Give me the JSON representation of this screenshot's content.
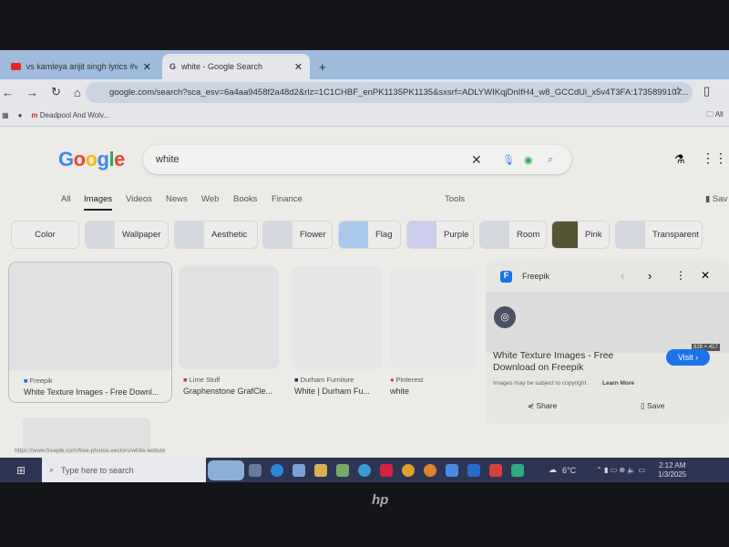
{
  "browser": {
    "tabs": [
      {
        "title": "vs kamleya arijit singh lyrics #v...",
        "icon": "youtube-icon",
        "active": false
      },
      {
        "title": "white - Google Search",
        "icon": "google-icon",
        "active": true
      }
    ],
    "new_tab": "+",
    "url": "google.com/search?sca_esv=6a4aa9458f2a48d2&rlz=1C1CHBF_enPK1135PK1135&sxsrf=ADLYWIKqjDnIfH4_w8_GCCdUi_x5v4T3FA:1735899107...",
    "bookmarks": [
      {
        "label": "Deadpool And Wolv...",
        "icon": "m-icon"
      }
    ],
    "all_bookmarks": "All"
  },
  "google": {
    "logo": "Google",
    "query": "white",
    "nav_tabs": [
      "All",
      "Images",
      "Videos",
      "News",
      "Web",
      "Books",
      "Finance"
    ],
    "active_tab": "Images",
    "tools": "Tools",
    "saved": "Sav",
    "chips": [
      "Color",
      "Wallpaper",
      "Aesthetic",
      "Flower",
      "Flag",
      "Purple",
      "Room",
      "Pink",
      "Transparent"
    ],
    "results": [
      {
        "source": "Freepik",
        "title": "White Texture Images - Free Downl..."
      },
      {
        "source": "Lime Stuff",
        "title": "Graphenstone GrafCle..."
      },
      {
        "source": "Durham Furniture",
        "title": "White | Durham Fu..."
      },
      {
        "source": "Pinterest",
        "title": "white"
      }
    ],
    "panel": {
      "source": "Freepik",
      "size": "828 × 417",
      "title": "White Texture Images - Free Download on Freepik",
      "visit": "Visit ›",
      "copyright": "Images may be subject to copyright.",
      "learn_more": "Learn More",
      "share": "Share",
      "save": "Save"
    },
    "status_url": "https://www.freepik.com/free-photos-vectors/white-texture"
  },
  "taskbar": {
    "search_placeholder": "Type here to search",
    "weather": "6°C",
    "time": "2:12 AM",
    "date": "1/3/2025"
  },
  "brand": "hp",
  "colors": {
    "accent": "#1a73e8",
    "taskbar": "#2d3553",
    "tabstrip": "#9fbbdc"
  }
}
